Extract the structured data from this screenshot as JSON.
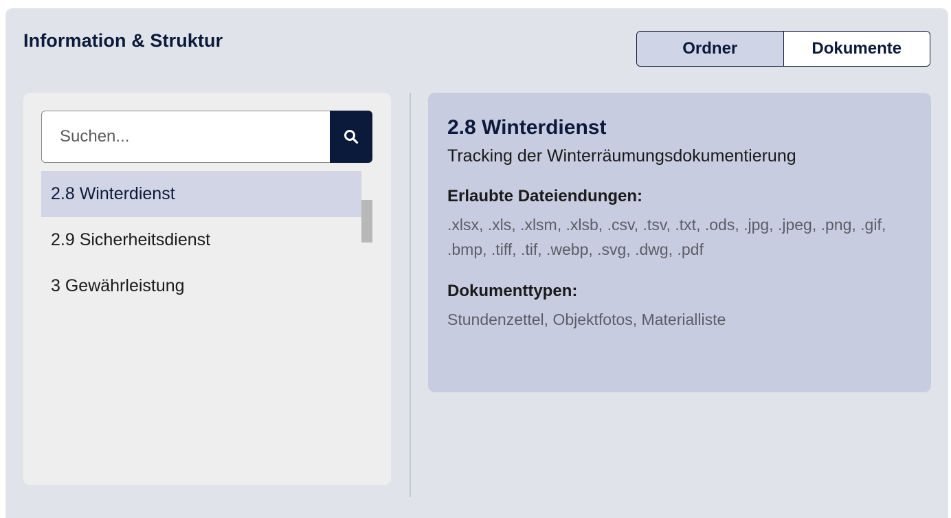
{
  "header": {
    "title": "Information & Struktur"
  },
  "view_toggle": {
    "options": [
      "Ordner",
      "Dokumente"
    ],
    "selected": "Ordner"
  },
  "search": {
    "placeholder": "Suchen...",
    "value": "",
    "icon": "search-icon"
  },
  "tree": {
    "items": [
      {
        "label": "2.8 Winterdienst",
        "selected": true
      },
      {
        "label": "2.9 Sicherheitsdienst",
        "selected": false
      },
      {
        "label": "3 Gewährleistung",
        "selected": false
      }
    ]
  },
  "detail": {
    "title": "2.8 Winterdienst",
    "description": "Tracking der Winterräumungsdokumentierung",
    "extensions_heading": "Erlaubte Dateiendungen:",
    "extensions": ".xlsx, .xls, .xlsm, .xlsb, .csv, .tsv, .txt, .ods, .jpg, .jpeg, .png, .gif, .bmp, .tiff, .tif, .webp, .svg, .dwg, .pdf",
    "doctypes_heading": "Dokumenttypen:",
    "doctypes": "Stundenzettel, Objektfotos, Materialliste"
  },
  "colors": {
    "primary": "#0b1a3a",
    "panel_bg": "#e0e3e9",
    "selected_bg": "#d2d5e6",
    "detail_bg": "#c8cce0"
  }
}
